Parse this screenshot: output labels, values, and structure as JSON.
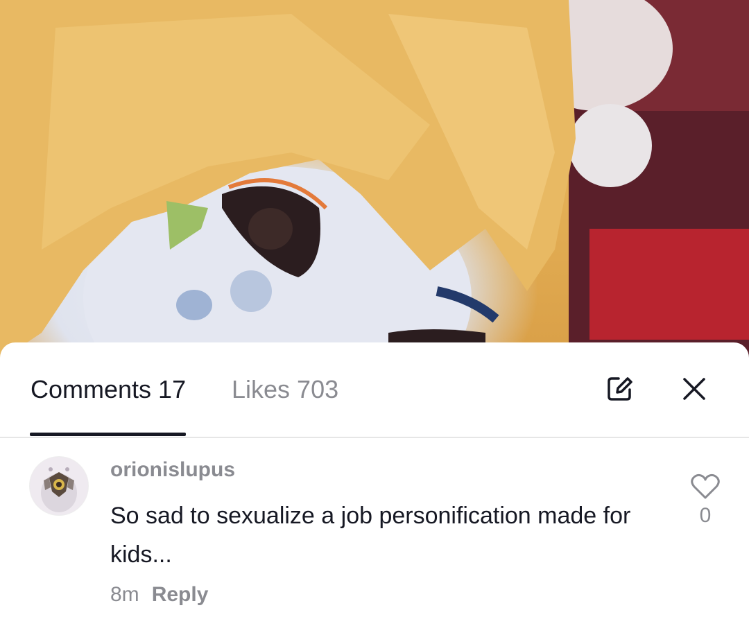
{
  "tabs": {
    "comments_label": "Comments 17",
    "likes_label": "Likes 703"
  },
  "icons": {
    "edit": "edit-icon",
    "close": "close-icon",
    "like": "heart-icon"
  },
  "comment": {
    "username": "orionislupus",
    "text": "So sad to sexualize a job personification made for kids...",
    "time": "8m",
    "reply_label": "Reply",
    "like_count": "0"
  },
  "colors": {
    "primary_text": "#161823",
    "secondary_text": "#8a8b91",
    "divider": "#e6e6e6"
  }
}
